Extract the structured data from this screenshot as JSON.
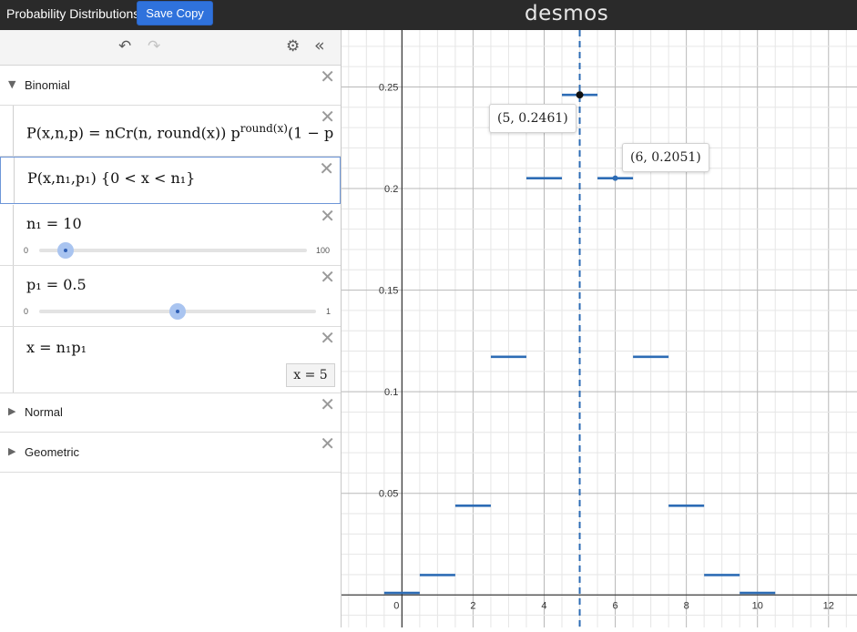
{
  "header": {
    "title": "Probability Distributions",
    "save_label": "Save Copy",
    "logo": "desmos"
  },
  "toolbar": {
    "undo_icon": "undo-icon",
    "redo_icon": "redo-icon",
    "settings_icon": "gear-icon",
    "collapse_icon": "double-chevron-left-icon"
  },
  "expressions": {
    "folder_binomial": "Binomial",
    "expr1": {
      "lhs": "P(x,n,p) = nCr(n, round(x)) p",
      "sup": "round(x)",
      "tail": "(1 − p"
    },
    "expr2": "P(x,n₁,p₁) {0 < x < n₁}",
    "n1": {
      "label": "n₁ = 10",
      "min": "0",
      "max": "100",
      "value": 10
    },
    "p1": {
      "label": "p₁ = 0.5",
      "min": "0",
      "max": "1",
      "value": 0.5
    },
    "x_def": {
      "label": "x = n₁p₁",
      "result": "x = 5"
    },
    "folder_normal": "Normal",
    "folder_geometric": "Geometric"
  },
  "colors": {
    "accent": "#2f72dc",
    "series": "#2d6cb5",
    "topbar": "#2a2a2a"
  },
  "chart_data": {
    "type": "step",
    "xlim": [
      -1.7,
      12.8
    ],
    "ylim": [
      -0.016,
      0.278
    ],
    "x_ticks": [
      "0",
      "2",
      "4",
      "6",
      "8",
      "10",
      "12"
    ],
    "y_ticks": [
      "0.05",
      "0.1",
      "0.15",
      "0.2",
      "0.25"
    ],
    "grid": true,
    "segments": [
      {
        "x": 0,
        "y": 0.001
      },
      {
        "x": 1,
        "y": 0.0098
      },
      {
        "x": 2,
        "y": 0.0439
      },
      {
        "x": 3,
        "y": 0.1172
      },
      {
        "x": 4,
        "y": 0.2051
      },
      {
        "x": 5,
        "y": 0.2461
      },
      {
        "x": 6,
        "y": 0.2051
      },
      {
        "x": 7,
        "y": 0.1172
      },
      {
        "x": 8,
        "y": 0.0439
      },
      {
        "x": 9,
        "y": 0.0098
      },
      {
        "x": 10,
        "y": 0.001
      }
    ],
    "vertical_line_x": 5,
    "points": [
      {
        "x": 5,
        "y": 0.2461,
        "label": "(5, 0.2461)"
      },
      {
        "x": 6,
        "y": 0.2051,
        "label": "(6, 0.2051)"
      }
    ]
  }
}
